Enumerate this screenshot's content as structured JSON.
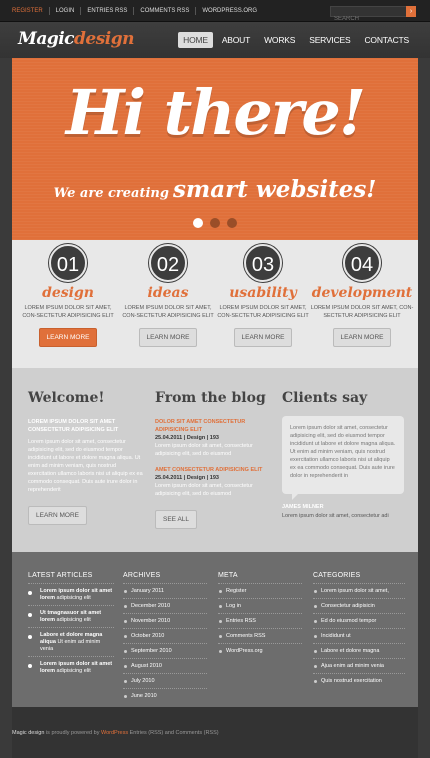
{
  "topbar": {
    "links": [
      "REGISTER",
      "LOGIN",
      "ENTRIES RSS",
      "COMMENTS RSS",
      "WORDPRESS.ORG"
    ],
    "search_placeholder": "SEARCH"
  },
  "header": {
    "logo_a": "Magic",
    "logo_b": "design",
    "nav": [
      "HOME",
      "ABOUT",
      "WORKS",
      "SERVICES",
      "CONTACTS"
    ]
  },
  "hero": {
    "title": "Hi there!",
    "sub_small": "We are creating",
    "sub_big": "smart websites!"
  },
  "features": [
    {
      "num": "01",
      "title": "design",
      "text": "LOREM IPSUM DOLOR SIT AMET, CON-SECTETUR ADIPISICING ELIT",
      "button": "LEARN MORE"
    },
    {
      "num": "02",
      "title": "ideas",
      "text": "LOREM IPSUM DOLOR SIT AMET, CON-SECTETUR ADIPISICING ELIT",
      "button": "LEARN MORE"
    },
    {
      "num": "03",
      "title": "usability",
      "text": "LOREM IPSUM DOLOR SIT AMET, CON-SECTETUR ADIPISICING ELIT",
      "button": "LEARN MORE"
    },
    {
      "num": "04",
      "title": "development",
      "text": "LOREM IPSUM DOLOR SIT AMET, CON-SECTETUR ADIPISICING ELIT",
      "button": "LEARN MORE"
    }
  ],
  "welcome": {
    "title": "Welcome!",
    "head": "LOREM IPSUM DOLOR SIT AMET CONSECTETUR ADIPISICING ELIT",
    "text": "Lorem ipsum dolor sit amet, consectetur adipisicing elit, sed do eiusmod tempor incididunt ut labore et dolore magna aliqua. Ut enim ad minim veniam, quis nostrud exercitation ullamco laboris nisi ut aliquip ex ea commodo consequat. Duis aute irure dolor in reprehenderit",
    "button": "LEARN MORE"
  },
  "blog": {
    "title": "From the blog",
    "posts": [
      {
        "title": "DOLOR SIT AMET CONSECTETUR ADIPISICING ELIT",
        "date": "25.04.2011",
        "cat": "Design",
        "count": "193",
        "text": "Lorem ipsum dolor sit amet, consectetur adipisicing elit, sed do eiusmod"
      },
      {
        "title": "AMET CONSECTETUR ADIPISICING ELIT",
        "date": "25.04.2011",
        "cat": "Design",
        "count": "193",
        "text": "Lorem ipsum dolor sit amet, consectetur adipisicing elit, sed do eiusmod"
      }
    ],
    "button": "SEE ALL"
  },
  "clients": {
    "title": "Clients say",
    "quote": "Lorem ipsum dolor sit amet, consectetur adipisicing elit, sed do eiusmod tempor incididunt ut labore et dolore magna aliqua. Ut enim ad minim veniam, quis nostrud exercitation ullamco laboris nisi ut aliquip ex ea commodo consequat. Duis aute irure dolor in reprehenderit in",
    "name": "JAMES MILNER",
    "text": "Lorem ipsum dolor sit amet, consectetur adi"
  },
  "widgets": {
    "latest": {
      "title": "LATEST ARTICLES",
      "items": [
        {
          "bold": "Lorem ipsum dolor sit amet lorem",
          "rest": "adipisicing elit"
        },
        {
          "bold": "Ut tmagnasuor sit amet lorem",
          "rest": "adipisicing elit"
        },
        {
          "bold": "Labore et dolore magna aliqua",
          "rest": "Ut enim ad minim venia"
        },
        {
          "bold": "Lorem ipsum dolor sit amet lorem",
          "rest": "adipisicing elit"
        }
      ]
    },
    "archives": {
      "title": "ARCHIVES",
      "items": [
        "January 2011",
        "December 2010",
        "November 2010",
        "October 2010",
        "September 2010",
        "August 2010",
        "July 2010",
        "June 2010"
      ]
    },
    "meta": {
      "title": "META",
      "items": [
        "Register",
        "Log in",
        "Entries RSS",
        "Comments RSS",
        "WordPress.org"
      ]
    },
    "categories": {
      "title": "CATEGORIES",
      "items": [
        "Lorem ipsum dolor sit amet,",
        "Consectetur adipisicin",
        "Ed do eiusmod tempor",
        "Incididunt ut",
        "Labore et dolore magna",
        "Ajua enim ad minim venia",
        "Quis nostrud exercitation"
      ]
    }
  },
  "footer": {
    "brand": "Magic design",
    "powered": "is proudly powered by",
    "wp": "WordPress",
    "feeds": "Entries (RSS) and Comments (RSS)"
  },
  "colors": {
    "accent": "#e0703a",
    "dark": "#3a3a3a"
  }
}
